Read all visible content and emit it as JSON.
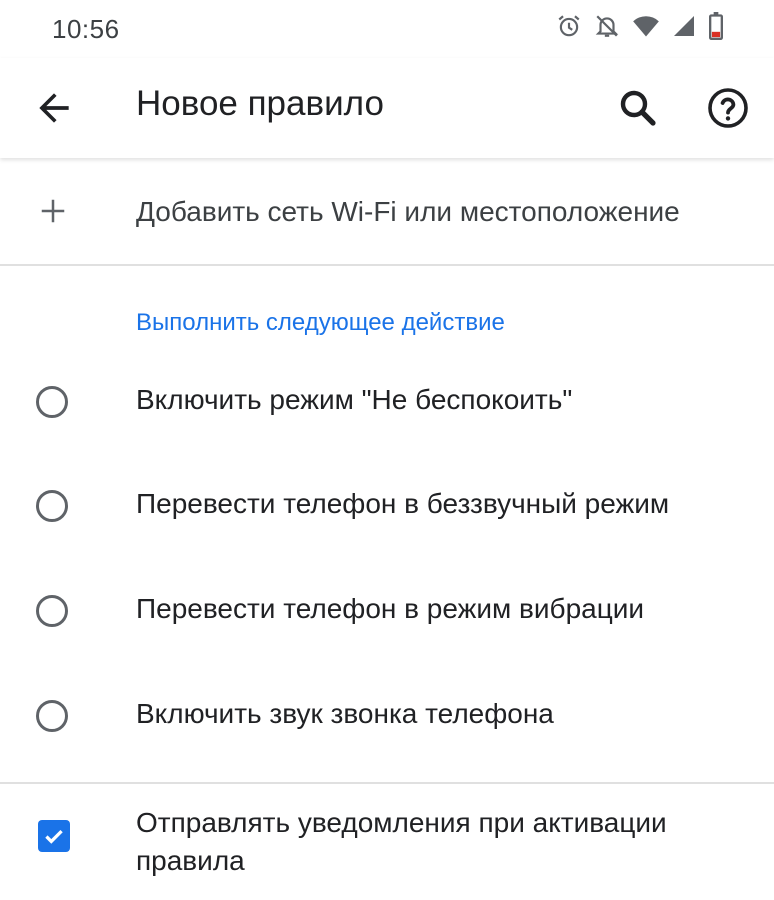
{
  "status_bar": {
    "time": "10:56",
    "icons": [
      "alarm-icon",
      "notifications-off-icon",
      "wifi-icon",
      "cell-signal-icon",
      "battery-low-icon"
    ]
  },
  "app_bar": {
    "title": "Новое правило",
    "icons": [
      "back-arrow-icon",
      "search-icon",
      "help-icon"
    ]
  },
  "add_location": {
    "label": "Добавить сеть Wi-Fi или местоположение",
    "icon": "plus-icon"
  },
  "action_section": {
    "header": "Выполнить следующее действие",
    "accent_color": "#1a73e8",
    "options": [
      {
        "label": "Включить режим \"Не беспокоить\"",
        "selected": false
      },
      {
        "label": "Перевести телефон в беззвучный режим",
        "selected": false
      },
      {
        "label": "Перевести телефон в режим вибрации",
        "selected": false
      },
      {
        "label": "Включить звук звонка телефона",
        "selected": false
      }
    ]
  },
  "notify": {
    "label": "Отправлять уведомления при активации правила",
    "checked": true
  },
  "colors": {
    "accent": "#1a73e8",
    "battery_low": "#d93025"
  }
}
